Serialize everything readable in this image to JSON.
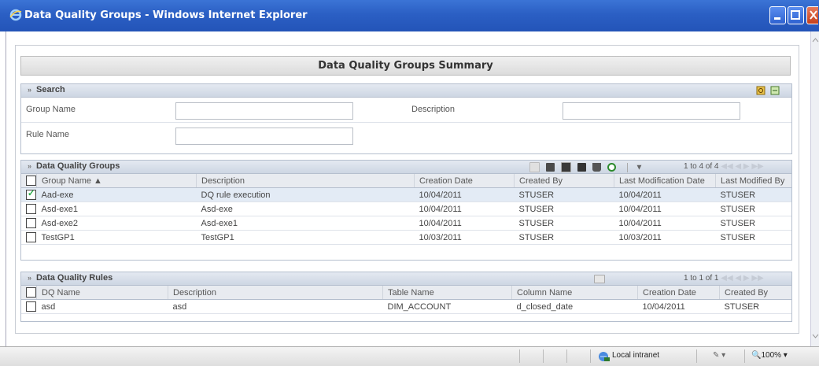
{
  "window": {
    "title": "Data Quality Groups - Windows Internet Explorer"
  },
  "page": {
    "summary_title": "Data Quality Groups Summary"
  },
  "search": {
    "title": "Search",
    "group_name_label": "Group Name",
    "group_name_value": "",
    "description_label": "Description",
    "description_value": "",
    "rule_name_label": "Rule Name",
    "rule_name_value": ""
  },
  "groups": {
    "title": "Data Quality Groups",
    "paging": "1 to 4 of 4",
    "columns": [
      "Group Name ▲",
      "Description",
      "Creation Date",
      "Created By",
      "Last Modification Date",
      "Last Modified By"
    ],
    "rows": [
      {
        "name": "Aad-exe",
        "description": "DQ rule execution",
        "creation_date": "10/04/2011",
        "created_by": "STUSER",
        "last_mod_date": "10/04/2011",
        "last_mod_by": "STUSER",
        "checked": true
      },
      {
        "name": "Asd-exe1",
        "description": "Asd-exe",
        "creation_date": "10/04/2011",
        "created_by": "STUSER",
        "last_mod_date": "10/04/2011",
        "last_mod_by": "STUSER",
        "checked": false
      },
      {
        "name": "Asd-exe2",
        "description": "Asd-exe1",
        "creation_date": "10/04/2011",
        "created_by": "STUSER",
        "last_mod_date": "10/04/2011",
        "last_mod_by": "STUSER",
        "checked": false
      },
      {
        "name": "TestGP1",
        "description": "TestGP1",
        "creation_date": "10/03/2011",
        "created_by": "STUSER",
        "last_mod_date": "10/03/2011",
        "last_mod_by": "STUSER",
        "checked": false
      }
    ]
  },
  "rules": {
    "title": "Data Quality Rules",
    "paging": "1 to 1 of 1",
    "columns": [
      "DQ Name",
      "Description",
      "Table Name",
      "Column Name",
      "Creation Date",
      "Created By"
    ],
    "rows": [
      {
        "name": "asd",
        "description": "asd",
        "table": "DIM_ACCOUNT",
        "column": "d_closed_date",
        "creation_date": "10/04/2011",
        "created_by": "STUSER",
        "checked": false
      }
    ]
  },
  "status": {
    "zone": "Local intranet",
    "zoom": "100%"
  },
  "colors": {
    "titlebar": "#2b5fc4",
    "panel_header": "#cdd6e3",
    "selected_row": "#e3ebf5"
  }
}
